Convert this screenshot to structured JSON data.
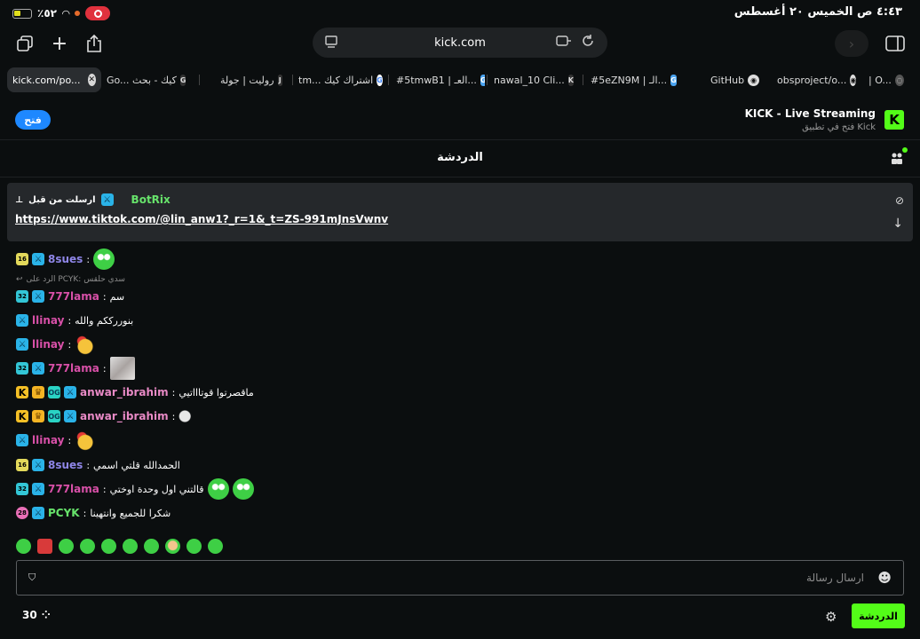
{
  "status": {
    "battery": "٪٥٢",
    "datetime": "٤:٤٣ ص  الخميس ٢٠ أغسطس"
  },
  "browser": {
    "url": "kick.com",
    "tabs": [
      {
        "label": "kick.com/po...",
        "icon": "close"
      },
      {
        "label": "Go... كيك - بحث",
        "icon": "G"
      },
      {
        "label": "روليت | جولة",
        "icon": "J"
      },
      {
        "label": "tm... اشتراك كيك",
        "icon": "google"
      },
      {
        "label": "#5tmwB1 | العـ...",
        "icon": "G"
      },
      {
        "label": "nawal_10 Cli...",
        "icon": "K"
      },
      {
        "label": "#5eZN9M | الـ...",
        "icon": "G"
      },
      {
        "label": "GitHub",
        "icon": "github"
      },
      {
        "label": "obsproject/o...",
        "icon": "github"
      },
      {
        "label": "| O...",
        "icon": "globe"
      }
    ]
  },
  "banner": {
    "open_label": "فتح",
    "title": "KICK - Live Streaming",
    "subtitle": "فتح في تطبيق Kick"
  },
  "chat": {
    "title": "الدردشة",
    "pinned": {
      "label": "ارسلت من قبل",
      "user": "BotRix",
      "link": "https://www.tiktok.com/@lin_anw1?_r=1&_t=ZS-991mJnsVwnv"
    },
    "reply": {
      "text": "الرد على PCYK: سدي حلقس"
    },
    "messages": [
      {
        "badges": [
          "16",
          "mod"
        ],
        "user": "8sues",
        "color": "sues",
        "text": "",
        "emote": "green"
      },
      {
        "badges": [
          "32",
          "mod"
        ],
        "user": "777lama",
        "color": "lama",
        "text": "سم",
        "emote": ""
      },
      {
        "badges": [
          "mod"
        ],
        "user": "llinay",
        "color": "llinay",
        "text": "بنوررككم والله",
        "emote": ""
      },
      {
        "badges": [
          "mod"
        ],
        "user": "llinay",
        "color": "llinay",
        "text": "",
        "emote": "heart"
      },
      {
        "badges": [
          "32",
          "mod"
        ],
        "user": "777lama",
        "color": "lama",
        "text": "",
        "emote": "photo"
      },
      {
        "badges": [
          "K",
          "crown",
          "OG",
          "mod"
        ],
        "user": "anwar_ibrahim",
        "color": "anwar",
        "text": "ماقصرتوا قوتاااتيي",
        "emote": ""
      },
      {
        "badges": [
          "K",
          "crown",
          "OG",
          "mod"
        ],
        "user": "anwar_ibrahim",
        "color": "anwar",
        "text": "",
        "emote": "heart2"
      },
      {
        "badges": [
          "mod"
        ],
        "user": "llinay",
        "color": "llinay",
        "text": "",
        "emote": "heart"
      },
      {
        "badges": [
          "16",
          "mod"
        ],
        "user": "8sues",
        "color": "sues",
        "text": "الحمدالله قلتي اسمي",
        "emote": ""
      },
      {
        "badges": [
          "32",
          "mod"
        ],
        "user": "777lama",
        "color": "lama",
        "text": "قالتني اول وحدة اوختي",
        "emote": "green2"
      },
      {
        "badges": [
          "28",
          "mod"
        ],
        "user": "PCYK",
        "color": "pcyk",
        "text": "شكرا للجميع وانتهينا",
        "emote": ""
      }
    ],
    "input_placeholder": "ارسال رسالة",
    "viewers": "30",
    "send_label": "الدردشة"
  }
}
